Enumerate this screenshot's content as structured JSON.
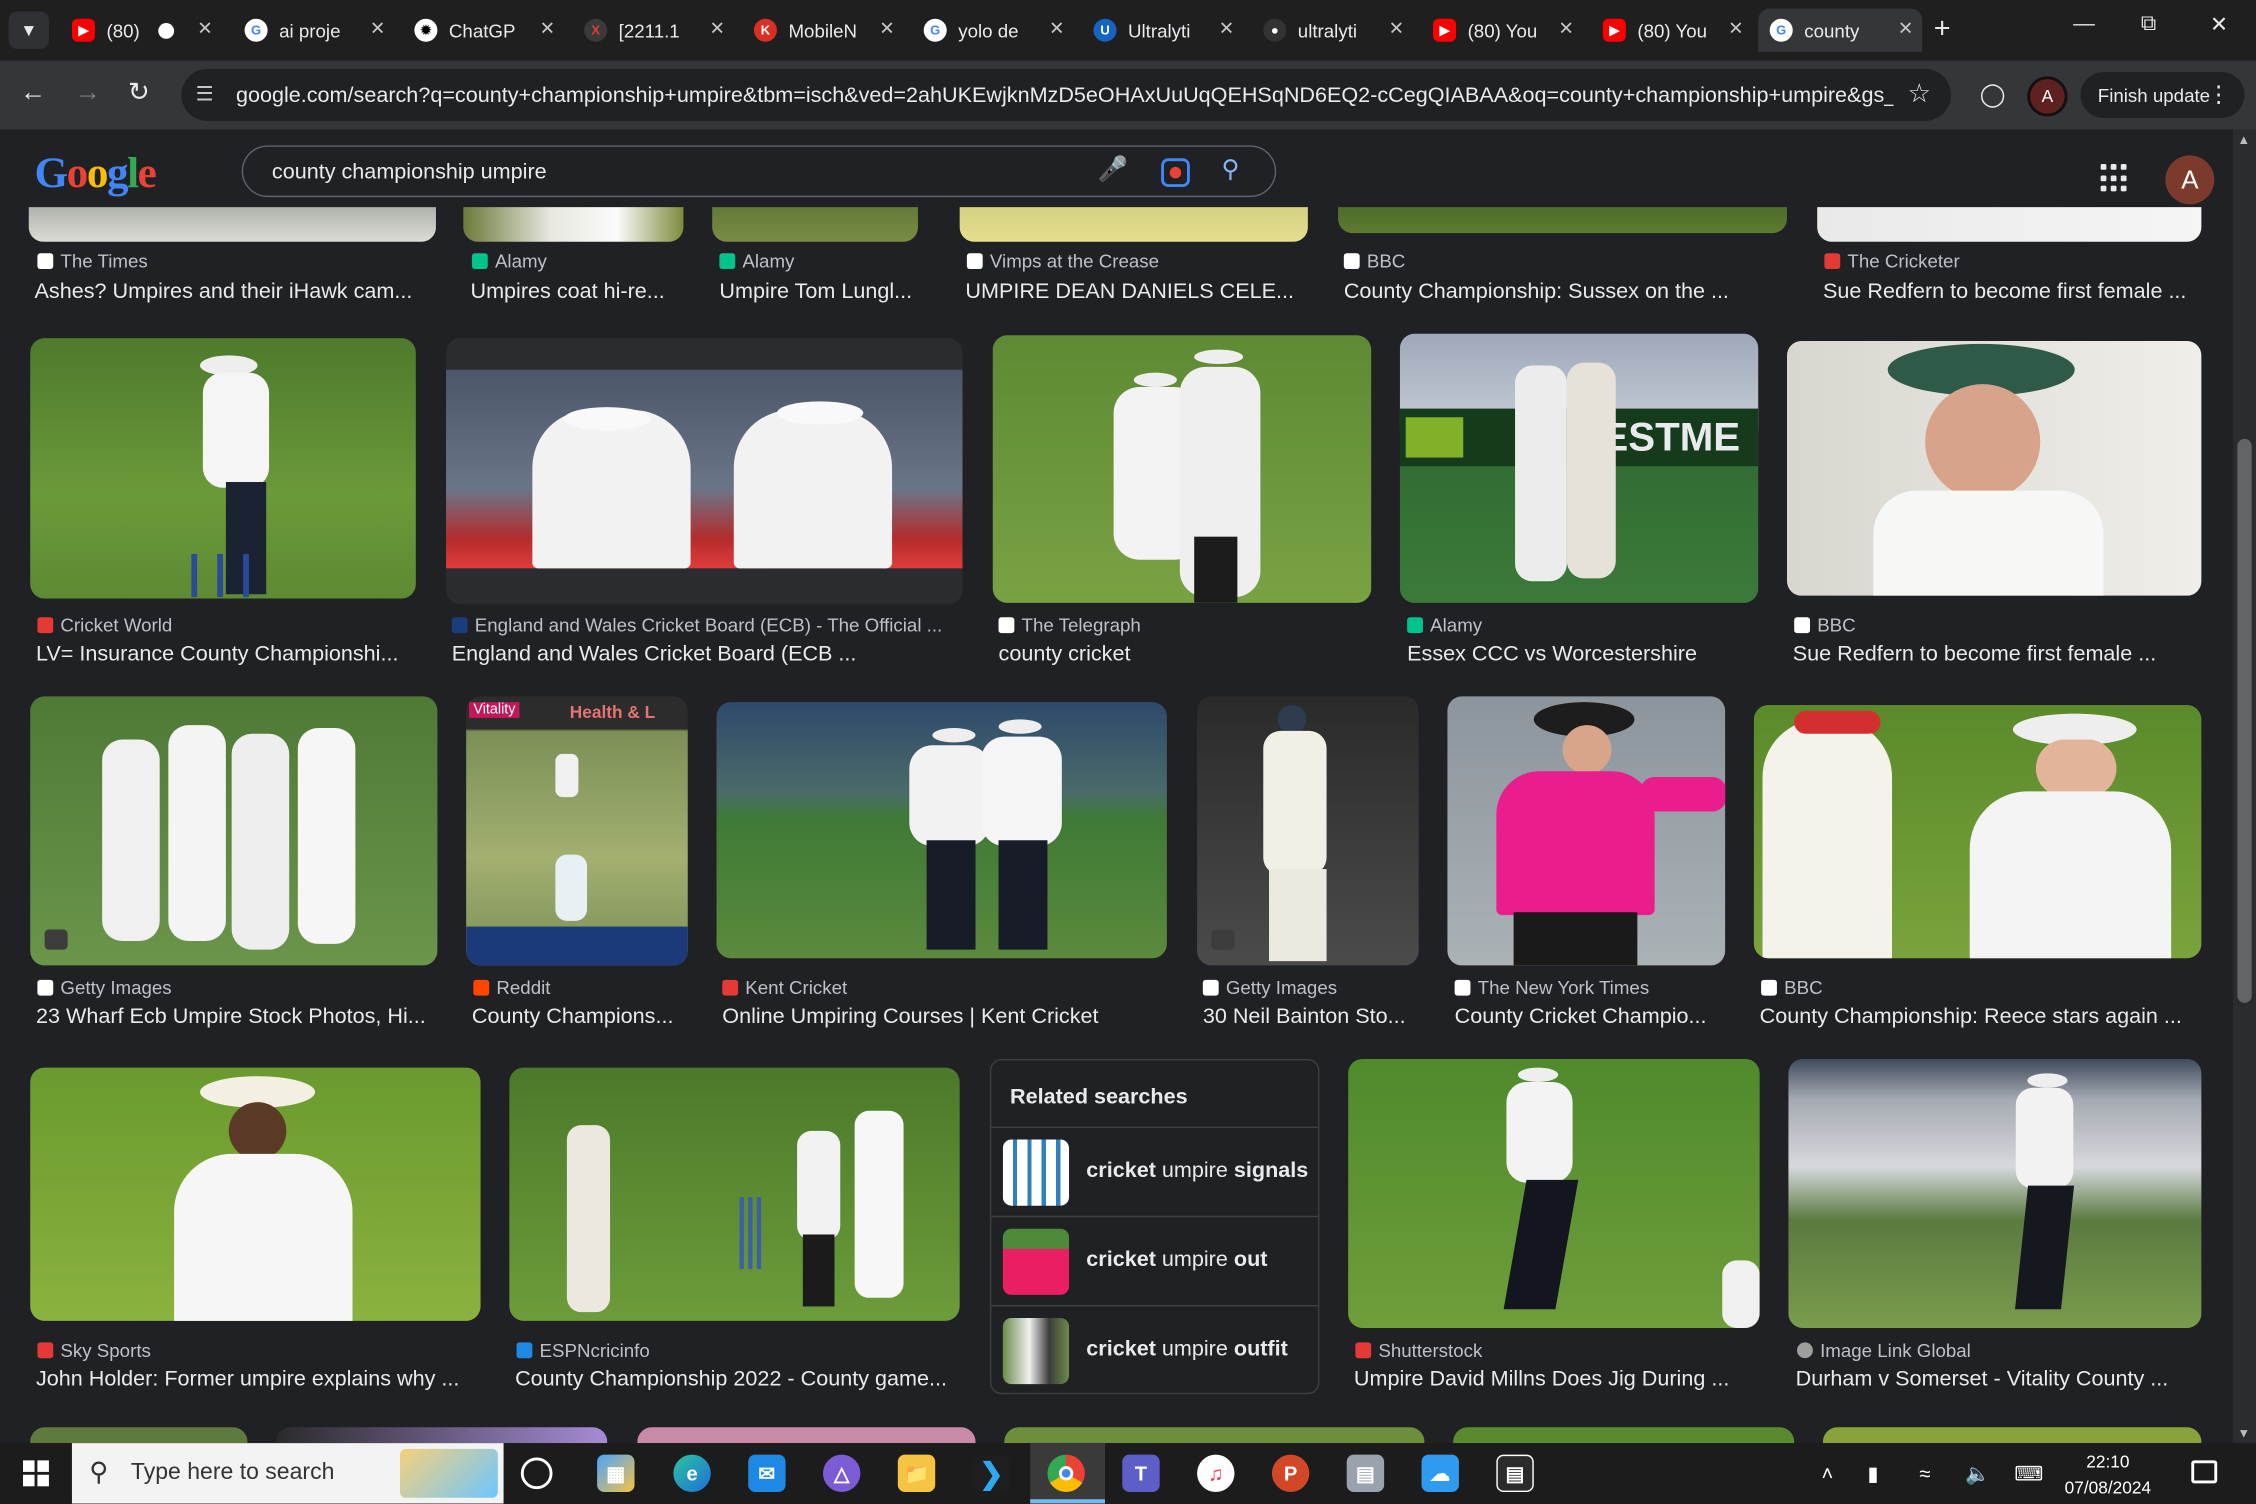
{
  "tabs": [
    {
      "title": "(80)",
      "favicon": "youtube-icon",
      "color": "#ff0000"
    },
    {
      "title": "ai proje",
      "favicon": "google-icon",
      "color": "#ffffff"
    },
    {
      "title": "ChatGP",
      "favicon": "chatgpt-icon",
      "color": "#ffffff"
    },
    {
      "title": "[2211.1",
      "favicon": "arxiv-icon",
      "color": "#b31b1b"
    },
    {
      "title": "MobileN",
      "favicon": "k-icon",
      "color": "#d93025"
    },
    {
      "title": "yolo de",
      "favicon": "google-icon",
      "color": "#ffffff"
    },
    {
      "title": "Ultralyti",
      "favicon": "ultralytics-icon",
      "color": "#1565c0"
    },
    {
      "title": "ultralyti",
      "favicon": "github-icon",
      "color": "#333333"
    },
    {
      "title": "(80) You",
      "favicon": "youtube-icon",
      "color": "#ff0000"
    },
    {
      "title": "(80) You",
      "favicon": "youtube-icon",
      "color": "#ff0000"
    },
    {
      "title": "county",
      "favicon": "google-icon",
      "color": "#ffffff"
    }
  ],
  "toolbar": {
    "url": "google.com/search?q=county+championship+umpire&tbm=isch&ved=2ahUKEwjknMzD5eOHAxUuUqQEHSqND6EQ2-cCegQIABAA&oq=county+championship+umpire&gs_lp...",
    "profile_initial": "A",
    "finish_update": "Finish update"
  },
  "search": {
    "query": "county championship umpire",
    "logo": "Google",
    "account_initial": "A"
  },
  "results": [
    {
      "source": "The Times",
      "caption": "Ashes? Umpires and their iHawk cam...",
      "icon_color": "#ffffff"
    },
    {
      "source": "Alamy",
      "caption": "Umpires coat hi-re...",
      "icon_color": "#00c48c"
    },
    {
      "source": "Alamy",
      "caption": "Umpire Tom Lungl...",
      "icon_color": "#00c48c"
    },
    {
      "source": "Vimps at the Crease",
      "caption": "UMPIRE DEAN DANIELS CELE...",
      "icon_color": "#ffffff"
    },
    {
      "source": "BBC",
      "caption": "County Championship: Sussex on the ...",
      "icon_color": "#ffffff"
    },
    {
      "source": "The Cricketer",
      "caption": "Sue Redfern to become first female ...",
      "icon_color": "#e53935"
    },
    {
      "source": "Cricket World",
      "caption": "LV= Insurance County Championshi...",
      "icon_color": "#e53935"
    },
    {
      "source": "England and Wales Cricket Board (ECB) - The Official ...",
      "caption": "England and Wales Cricket Board (ECB ...",
      "icon_color": "#1a3d7c"
    },
    {
      "source": "The Telegraph",
      "caption": "county cricket",
      "icon_color": "#ffffff"
    },
    {
      "source": "Alamy",
      "caption": "Essex CCC vs Worcestershire",
      "icon_color": "#00c48c"
    },
    {
      "source": "BBC",
      "caption": "Sue Redfern to become first female ...",
      "icon_color": "#ffffff"
    },
    {
      "source": "Getty Images",
      "caption": "23 Wharf Ecb Umpire Stock Photos, Hi...",
      "icon_color": "#ffffff"
    },
    {
      "source": "Reddit",
      "caption": "County Champions...",
      "icon_color": "#ff4500"
    },
    {
      "source": "Kent Cricket",
      "caption": "Online Umpiring Courses | Kent Cricket",
      "icon_color": "#e53935"
    },
    {
      "source": "Getty Images",
      "caption": "30 Neil Bainton Sto...",
      "icon_color": "#ffffff"
    },
    {
      "source": "The New York Times",
      "caption": "County Cricket Champio...",
      "icon_color": "#ffffff"
    },
    {
      "source": "BBC",
      "caption": "County Championship: Reece stars again ...",
      "icon_color": "#ffffff"
    },
    {
      "source": "Sky Sports",
      "caption": "John Holder: Former umpire explains why ...",
      "icon_color": "#e53935"
    },
    {
      "source": "ESPNcricinfo",
      "caption": "County Championship 2022 - County game...",
      "icon_color": "#1e88e5"
    },
    {
      "source": "Shutterstock",
      "caption": "Umpire David Millns Does Jig During ...",
      "icon_color": "#e53935"
    },
    {
      "source": "Image Link Global",
      "caption": "Durham v Somerset - Vitality County ...",
      "icon_color": "#9e9e9e"
    }
  ],
  "related": {
    "heading": "Related searches",
    "items": [
      {
        "prefix": "cricket",
        "middle": "umpire",
        "suffix": "signals"
      },
      {
        "prefix": "cricket",
        "middle": "umpire",
        "suffix": "out"
      },
      {
        "prefix": "cricket",
        "middle": "umpire",
        "suffix": "outfit"
      }
    ]
  },
  "image_text": {
    "vitality": "Vitality",
    "health": "Health & L",
    "estme": "ESTME"
  },
  "taskbar": {
    "search_placeholder": "Type here to search",
    "time": "22:10",
    "date": "07/08/2024"
  }
}
